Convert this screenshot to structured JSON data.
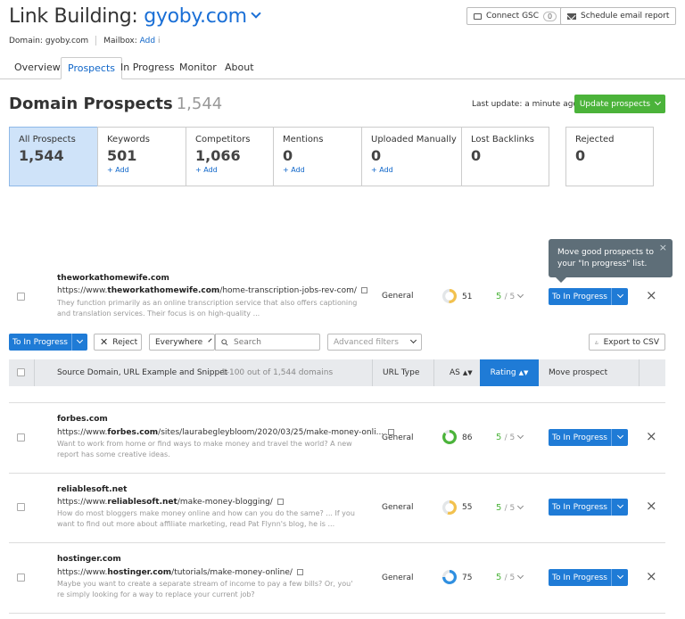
{
  "header": {
    "title_prefix": "Link Building: ",
    "title_domain": "gyoby.com",
    "domain_label": "Domain: gyoby.com",
    "mailbox_label": "Mailbox:",
    "mailbox_add": "Add",
    "info_glyph": "i",
    "connect_gsc": "Connect GSC",
    "gsc_count": "0",
    "schedule_email": "Schedule email report"
  },
  "tabs": [
    {
      "label": "Overview"
    },
    {
      "label": "Prospects",
      "active": true
    },
    {
      "label": "In Progress"
    },
    {
      "label": "Monitor"
    },
    {
      "label": "About"
    }
  ],
  "section": {
    "title": "Domain Prospects",
    "count": "1,544",
    "last_update": "Last update: a minute ago",
    "update_button": "Update prospects"
  },
  "stats": [
    {
      "label": "All Prospects",
      "value": "1,544",
      "add": ""
    },
    {
      "label": "Keywords",
      "value": "501",
      "add": "+ Add"
    },
    {
      "label": "Competitors",
      "value": "1,066",
      "add": "+ Add"
    },
    {
      "label": "Mentions",
      "value": "0",
      "add": "+ Add"
    },
    {
      "label": "Uploaded Manually",
      "value": "0",
      "add": "+ Add"
    },
    {
      "label": "Lost Backlinks",
      "value": "0",
      "add": ""
    },
    {
      "label": "Rejected",
      "value": "0",
      "add": ""
    }
  ],
  "tooltip": {
    "text": "Move good prospects to your \"In progress\" list.",
    "close": "×"
  },
  "toolbar": {
    "to_in_progress": "To In Progress",
    "reject": "Reject",
    "scope": "Everywhere",
    "search_placeholder": "Search",
    "advanced_filters": "Advanced filters",
    "export": "Export to CSV"
  },
  "table": {
    "col_source": "Source Domain, URL Example and Snippet",
    "col_range": "1-100 out of 1,544 domains",
    "col_url_type": "URL Type",
    "col_as": "AS",
    "col_rating": "Rating",
    "col_move": "Move prospect"
  },
  "rows": [
    {
      "domain": "theworkathomewife.com",
      "url_pre": "https://www.",
      "url_bold": "theworkathomewife.com",
      "url_post": "/home-transcription-jobs-rev-com/",
      "snippet": "They function primarily as an online transcription service that also offers captioning and translation services. Their focus is on high-quality ...",
      "url_type": "General",
      "as": "51",
      "as_color": "#f2c14e",
      "as_pct": 0.51,
      "rating": "5",
      "rating_of": "/ 5",
      "move_label": "To In Progress",
      "reject_glyph": "×"
    },
    {
      "domain": "forbes.com",
      "url_pre": "https://www.",
      "url_bold": "forbes.com",
      "url_post": "/sites/laurabegleybloom/2020/03/25/make-money-onli...",
      "snippet": "Want to work from home or find ways to make money and travel the world? A new report has some creative ideas.",
      "url_type": "General",
      "as": "86",
      "as_color": "#4bb33a",
      "as_pct": 0.86,
      "rating": "5",
      "rating_of": "/ 5",
      "move_label": "To In Progress",
      "reject_glyph": "×"
    },
    {
      "domain": "reliablesoft.net",
      "url_pre": "https://www.",
      "url_bold": "reliablesoft.net",
      "url_post": "/make-money-blogging/",
      "snippet": "How do most bloggers make money online and how can you do the same? ... If you want to find out more about affiliate marketing, read Pat Flynn's blog, he is ...",
      "url_type": "General",
      "as": "55",
      "as_color": "#f2c14e",
      "as_pct": 0.55,
      "rating": "5",
      "rating_of": "/ 5",
      "move_label": "To In Progress",
      "reject_glyph": "×"
    },
    {
      "domain": "hostinger.com",
      "url_pre": "https://www.",
      "url_bold": "hostinger.com",
      "url_post": "/tutorials/make-money-online/",
      "snippet": "Maybe you want to create a separate stream of income to pay a few bills? Or, you' re simply looking for a way to replace your current job?",
      "url_type": "General",
      "as": "75",
      "as_color": "#2f8fe0",
      "as_pct": 0.75,
      "rating": "5",
      "rating_of": "/ 5",
      "move_label": "To In Progress",
      "reject_glyph": "×"
    }
  ]
}
